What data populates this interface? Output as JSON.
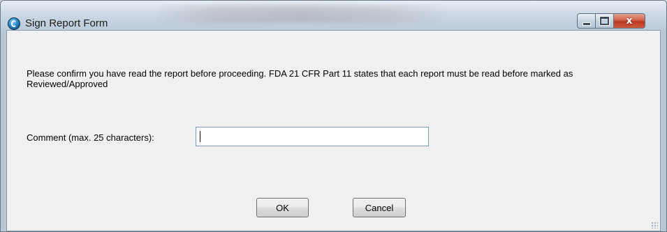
{
  "window": {
    "title": "Sign Report Form",
    "controls": {
      "minimize": "minimize",
      "maximize": "maximize",
      "close": "x"
    }
  },
  "form": {
    "message": "Please confirm you have read the report before proceeding. FDA 21 CFR Part 11 states that each report must be read before marked as Reviewed/Approved",
    "comment_label": "Comment (max. 25 characters):",
    "comment_value": "",
    "ok_label": "OK",
    "cancel_label": "Cancel"
  },
  "icons": {
    "app": "app-logo-icon",
    "minimize": "minimize-icon",
    "maximize": "maximize-icon",
    "close": "close-icon",
    "resize": "resize-grip-icon"
  },
  "colors": {
    "close_button": "#c8452c",
    "dialog_background": "#f0f0f0",
    "input_border": "#7a9cc4"
  }
}
